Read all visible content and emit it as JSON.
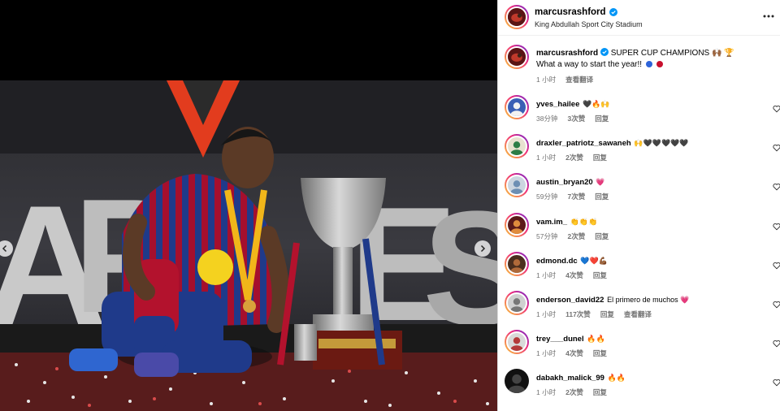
{
  "post": {
    "author": "marcusrashford",
    "location": "King Abdullah Sport City Stadium",
    "caption_text": "SUPER CUP CHAMPIONS 🙌🏾 🏆",
    "caption_line2": "What a way to start the year!!",
    "caption_time": "1 小时",
    "translate_label": "查看翻译",
    "verified_color": "#0095f6"
  },
  "comments": [
    {
      "user": "yves_hailee",
      "text": "🖤🔥🙌",
      "time": "38分钟",
      "likes": "3次赞",
      "reply": "回复"
    },
    {
      "user": "draxler_patriotz_sawaneh",
      "text": "🙌🖤🖤🖤🖤🖤",
      "time": "1 小时",
      "likes": "2次赞",
      "reply": "回复"
    },
    {
      "user": "austin_bryan20",
      "text": "💗",
      "time": "59分钟",
      "likes": "7次赞",
      "reply": "回复"
    },
    {
      "user": "vam.im_",
      "text": "👏👏👏",
      "time": "57分钟",
      "likes": "2次赞",
      "reply": "回复"
    },
    {
      "user": "edmond.dc",
      "text": "💙❤️💪🏾",
      "time": "1 小时",
      "likes": "4次赞",
      "reply": "回复"
    },
    {
      "user": "enderson_david22",
      "text": "El primero de muchos 💗",
      "time": "1 小时",
      "likes": "117次赞",
      "reply": "回复",
      "translate": "查看翻译"
    },
    {
      "user": "trey___dunel",
      "text": "🔥🔥",
      "time": "1 小时",
      "likes": "4次赞",
      "reply": "回复"
    },
    {
      "user": "dabakh_malick_99",
      "text": "🔥🔥",
      "time": "1 小时",
      "likes": "2次赞",
      "reply": "回复"
    }
  ],
  "photo_banner_letters": "APEONES",
  "icons": {
    "verified": "verified-badge-icon",
    "more": "more-options-icon",
    "heart": "heart-outline-icon",
    "prev": "chevron-left-icon",
    "next": "chevron-right-icon"
  }
}
